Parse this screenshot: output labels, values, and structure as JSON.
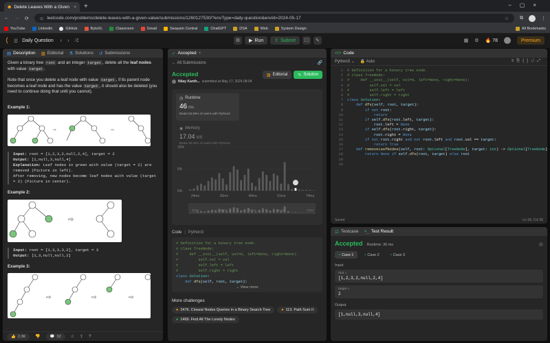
{
  "browser": {
    "tab_title": "Delete Leaves With a Given Val",
    "url": "leetcode.com/problems/delete-leaves-with-a-given-value/submissions/1260127530/?envType=daily-question&envId=2024-05-17",
    "bookmarks": [
      "YouTube",
      "LinkedIn",
      "GitHub",
      "BytoXL",
      "Classroom",
      "Gmail",
      "Swayam Central",
      "ChatGPT",
      "DSA",
      "Web",
      "System Design"
    ],
    "all_bookmarks": "All Bookmarks"
  },
  "nav": {
    "daily": "Daily Question",
    "run": "Run",
    "submit": "Submit",
    "streak": "78",
    "premium": "Premium"
  },
  "left": {
    "tabs": [
      "Description",
      "Editorial",
      "Solutions",
      "Submissions"
    ],
    "intro_1": "Given a binary tree",
    "intro_root": "root",
    "intro_2": "and an integer",
    "intro_target": "target",
    "intro_3": ", delete all the",
    "intro_bold": "leaf nodes",
    "intro_4": "with value",
    "intro_target2": "target",
    "intro_5": ".",
    "note_1": "Note that once you delete a leaf node with value",
    "note_target": "target",
    "note_2": ", if its parent node becomes a leaf node and has the value",
    "note_target2": "target",
    "note_3": ", it should also be deleted (you need to continue doing that until you cannot).",
    "ex1_title": "Example 1:",
    "ex1_input_label": "Input:",
    "ex1_input": "root = [1,2,3,2,null,2,4], target = 2",
    "ex1_output_label": "Output:",
    "ex1_output": "[1,null,3,null,4]",
    "ex1_expl_label": "Explanation:",
    "ex1_expl": "Leaf nodes in green with value (target = 2) are removed (Picture in left).",
    "ex1_expl2": "After removing, new nodes become leaf nodes with value (target = 2) (Picture in center).",
    "ex2_title": "Example 2:",
    "ex2_input_label": "Input:",
    "ex2_input": "root = [1,3,3,3,2], target = 3",
    "ex2_output_label": "Output:",
    "ex2_output": "[1,3,null,null,2]",
    "ex3_title": "Example 3:",
    "likes": "2.3K",
    "comments": "32"
  },
  "accepted_panel": {
    "tab": "Accepted",
    "all_submissions": "All Submissions",
    "status": "Accepted",
    "user": "Nilay Kanth...",
    "submitted": "submitted at May 17, 2024 08:04",
    "editorial_btn": "Editorial",
    "solution_btn": "Solution",
    "runtime_label": "Runtime",
    "runtime_val": "46",
    "runtime_unit": "ms",
    "runtime_beats": "Beats 53.59% of users with Python3",
    "memory_label": "Memory",
    "memory_val": "17.04",
    "memory_unit": "MB",
    "memory_beats": "Beats 30.25% of users with Python3",
    "y_ticks": [
      "10%",
      "5%",
      "0%"
    ],
    "x_ticks": [
      "24ms",
      "36ms",
      "49ms",
      "61ms",
      "74ms"
    ],
    "code_label": "Code",
    "code_lang": "Python3",
    "view_more": "View more",
    "more_challenges": "More challenges",
    "challenges": [
      "2476. Closest Nodes Queries in a Binary Search Tree",
      "113. Path Sum II",
      "1469. Find All The Lonely Nodes"
    ]
  },
  "editor": {
    "tab": "Code",
    "lang": "Python3",
    "auto": "Auto",
    "saved": "Saved",
    "cursor": "Ln 18, Col 36"
  },
  "result": {
    "tabs": [
      "Testcase",
      "Test Result"
    ],
    "status": "Accepted",
    "runtime": "Runtime: 36 ms",
    "cases": [
      "Case 1",
      "Case 2",
      "Case 3"
    ],
    "input_label": "Input",
    "root_label": "root =",
    "root_val": "[1,2,3,2,null,2,4]",
    "target_label": "target =",
    "target_val": "2",
    "output_label": "Output",
    "output_val": "[1,null,3,null,4]"
  },
  "code_lines": [
    "# Definition for a binary tree node.",
    "# class TreeNode:",
    "#     def __init__(self, val=0, left=None, right=None):",
    "#         self.val = val",
    "#         self.left = left",
    "#         self.right = right",
    "class Solution:",
    "    def dfs(self, root, target):",
    "        if not root:",
    "            return",
    "        if self.dfs(root.left, target):",
    "            root.left = None",
    "        if self.dfs(root.right, target):",
    "            root.right = None",
    "        if not root.right and not root.left and root.val == target:",
    "            return True",
    "    def removeLeafNodes(self, root: Optional[TreeNode], target: int) -> Optional[TreeNode]:",
    "        return None if self.dfs(root, target) else root",
    "",
    ""
  ],
  "snippet_lines": [
    "# Definition for a binary tree node.",
    "# class TreeNode:",
    "#     def __init__(self, val=0, left=None, right=None):",
    "#         self.val = val",
    "#         self.left = left",
    "#         self.right = right",
    "class Solution:",
    "    def dfs(self, root, target):"
  ],
  "chart_data": {
    "type": "bar",
    "title": "",
    "xlabel": "",
    "ylabel": "",
    "x": [
      "24ms",
      "36ms",
      "49ms",
      "61ms",
      "74ms"
    ],
    "values": [
      0.3,
      0.5,
      1.2,
      1.6,
      1.2,
      2.2,
      3.0,
      2.6,
      4.0,
      2.8,
      1.4,
      4.2,
      5.6,
      4.8,
      2.4,
      3.6,
      5.0,
      1.8,
      1.0,
      2.9,
      4.4,
      3.6,
      2.2,
      3.9,
      3.5,
      1.6,
      6.5,
      1.5,
      0.4,
      0.6,
      0.3,
      0.2,
      0.2,
      0.2,
      0.1
    ],
    "highlight_index": 29,
    "ylim": [
      0,
      10
    ],
    "colors": {
      "bar": "#5a5a5a",
      "highlight": "#ffffff"
    }
  },
  "colors": {
    "accent": "#2cbb5d",
    "premium": "#ffa116"
  }
}
